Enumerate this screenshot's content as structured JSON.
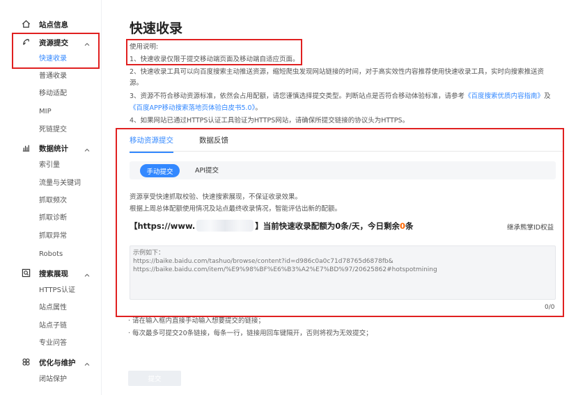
{
  "sidebar": {
    "sections": [
      {
        "label": "站点信息",
        "icon": "home-icon"
      },
      {
        "label": "资源提交",
        "icon": "submit-resource-icon"
      },
      {
        "label": "数据统计",
        "icon": "stats-icon"
      },
      {
        "label": "搜索展现",
        "icon": "search-display-icon"
      },
      {
        "label": "优化与维护",
        "icon": "optimize-icon"
      }
    ],
    "resource_items": [
      "快速收录",
      "普通收录",
      "移动适配",
      "MIP",
      "死链提交"
    ],
    "stats_items": [
      "索引量",
      "流量与关键词",
      "抓取频次",
      "抓取诊断",
      "抓取异常",
      "Robots"
    ],
    "search_items": [
      "HTTPS认证",
      "站点属性",
      "站点子链",
      "专业问答"
    ],
    "optimize_items": [
      "闭站保护"
    ]
  },
  "main": {
    "title": "快速收录",
    "instructions": {
      "heading": "使用说明:",
      "line1": "1、快速收录仅限于提交移动端页面及移动端自适应页面。",
      "line2a": "2、快速收录工具可以向百度搜索主动推送资源，缩短爬虫发现网站链接的时间，对于高实效性内容推荐使用快速收录工具，实时向搜索推送资",
      "line2b": "源。",
      "line3a": "3、资源不符合移动资源标准，依然会占用配额，请您谨慎选择提交类型。判断站点是否符合移动体验标准，请参考",
      "link1": "《百度搜索优质内容指南》",
      "line3b": "及",
      "link2": "《百度APP移动搜索落地页体验白皮书5.0》",
      "line3c": "。",
      "line4": "4、如果网站已通过HTTPS认证工具验证为HTTPS网站，请确保所提交链接的协议头为HTTPS。"
    },
    "tabs": [
      "移动资源提交",
      "数据反馈"
    ],
    "subtabs": [
      "手动提交",
      "API提交"
    ],
    "desc1": "资源享受快速抓取校验、快速搜索展现，不保证收录效果。",
    "desc2": "根据上周总体配额使用情况及站点最终收录情况，智能评估出新的配额。",
    "quota": {
      "prefix": "【https://www.",
      "middle": "】当前快速收录配额为0条/天，今日剩余",
      "remaining": "0",
      "suffix": "条"
    },
    "inherit_label": "继承熊掌ID权益",
    "textarea_placeholder": "示例如下：\nhttps://baike.baidu.com/tashuo/browse/content?id=d986c0a0c71d78765d6878fb&\nhttps://baike.baidu.com/item/%E9%98%BF%E6%B3%A2%E7%BD%97/20625862#hotspotmining",
    "counter": "0/0",
    "note1": "· 请在输入框内直接手动输入想要提交的链接；",
    "note2": "· 每次最多可提交20条链接，每条一行，链接用回车键隔开，否则将视为无效提交；",
    "submit_label": "提交"
  },
  "colors": {
    "accent": "#3388ff",
    "highlight_box": "#e02020",
    "remaining": "#ff6600"
  }
}
